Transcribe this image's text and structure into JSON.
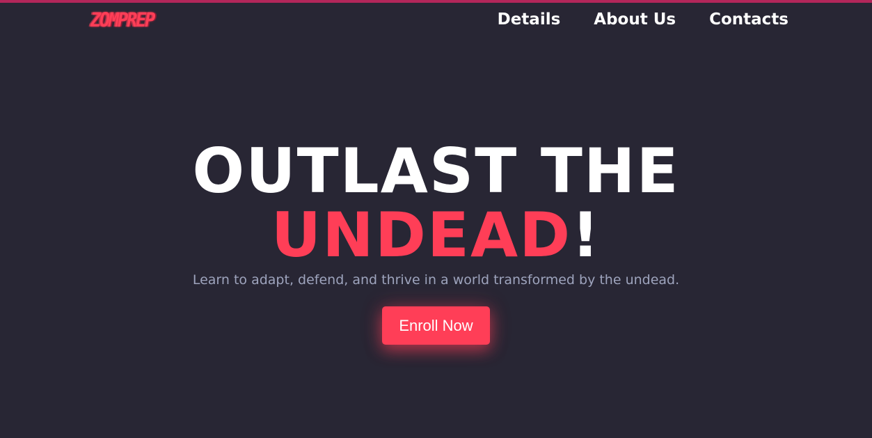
{
  "header": {
    "logo_text": "ZOMPREP",
    "nav_items": [
      {
        "label": "Details"
      },
      {
        "label": "About Us"
      },
      {
        "label": "Contacts"
      }
    ]
  },
  "hero": {
    "headline_line1": "OUTLAST THE",
    "headline_line2_prefix": "",
    "headline_accent": "UNDEAD",
    "headline_suffix": "!",
    "subtitle": "Learn to adapt, defend, and thrive in a world transformed by the undead.",
    "cta_label": "Enroll Now"
  },
  "colors": {
    "background": "#282634",
    "accent": "#ff3e57",
    "top_bar": "#b3265a",
    "subtitle_text": "#9ea4bd",
    "text": "#ffffff"
  }
}
